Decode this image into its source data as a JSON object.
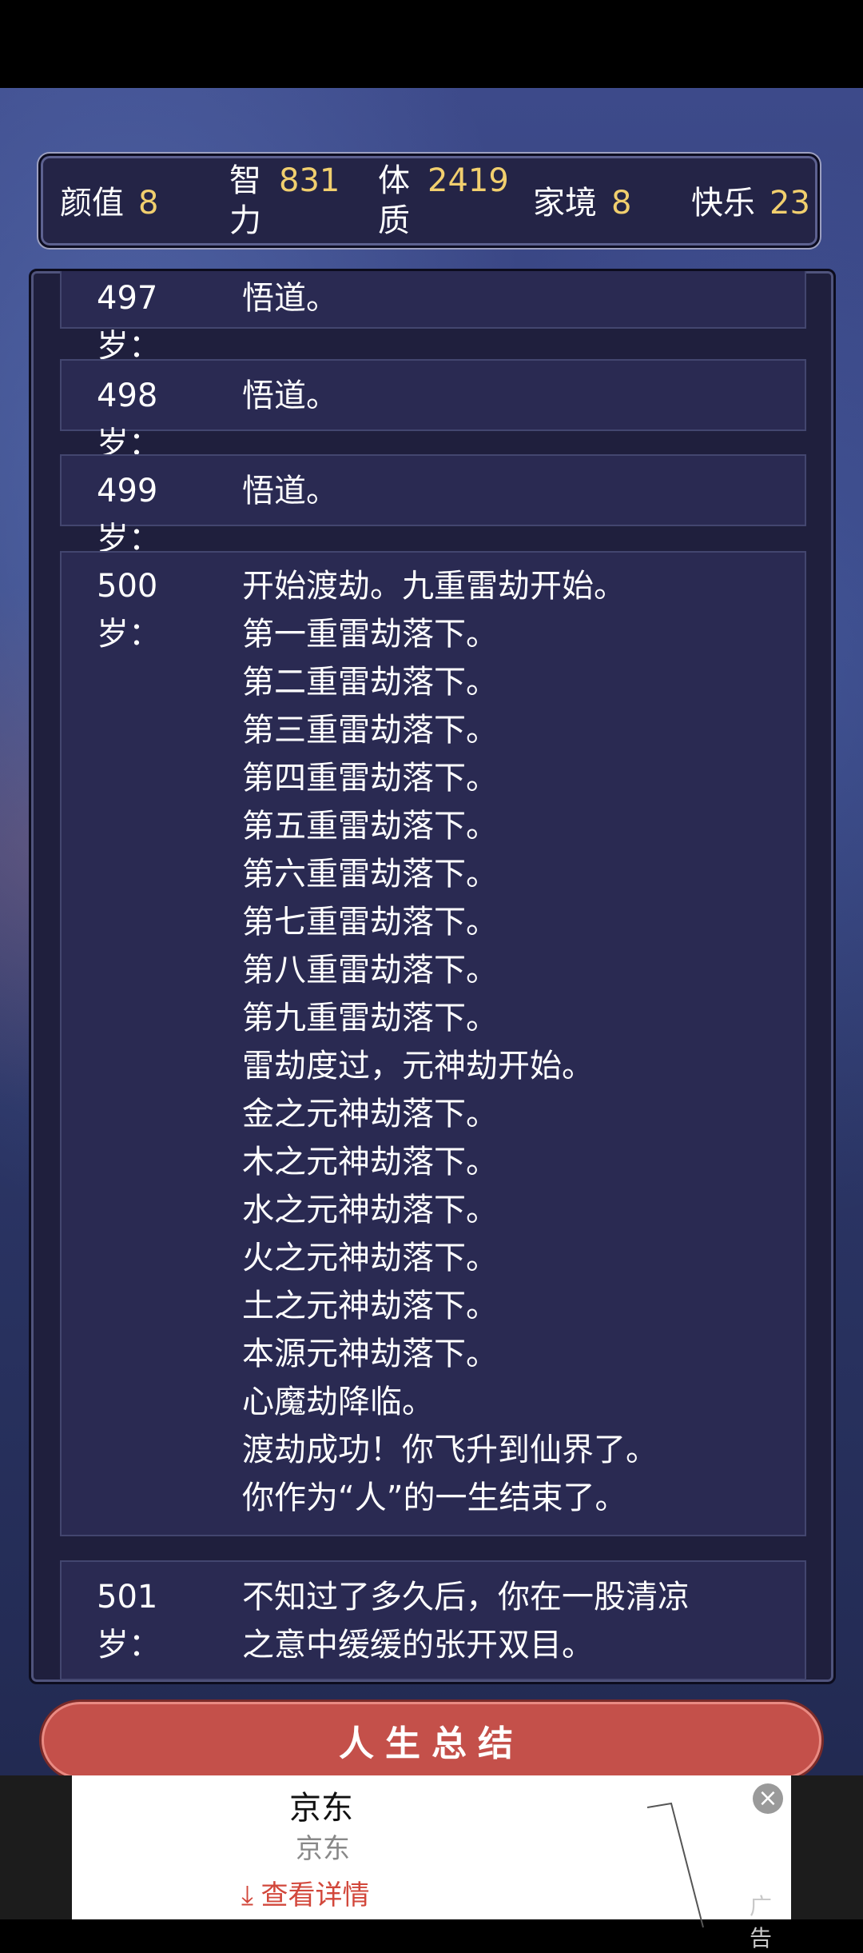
{
  "stats": [
    {
      "label": "颜值",
      "value": "8"
    },
    {
      "label": "智力",
      "value": "831"
    },
    {
      "label": "体质",
      "value": "2419"
    },
    {
      "label": "家境",
      "value": "8"
    },
    {
      "label": "快乐",
      "value": "23"
    }
  ],
  "log": [
    {
      "age": "497岁：",
      "lines": [
        "悟道。"
      ]
    },
    {
      "age": "498岁：",
      "lines": [
        "悟道。"
      ]
    },
    {
      "age": "499岁：",
      "lines": [
        "悟道。"
      ]
    },
    {
      "age": "500岁：",
      "lines": [
        "开始渡劫。九重雷劫开始。",
        "第一重雷劫落下。",
        "第二重雷劫落下。",
        "第三重雷劫落下。",
        "第四重雷劫落下。",
        "第五重雷劫落下。",
        "第六重雷劫落下。",
        "第七重雷劫落下。",
        "第八重雷劫落下。",
        "第九重雷劫落下。",
        "雷劫度过，元神劫开始。",
        "金之元神劫落下。",
        "木之元神劫落下。",
        "水之元神劫落下。",
        "火之元神劫落下。",
        "土之元神劫落下。",
        "本源元神劫落下。",
        "心魔劫降临。",
        "渡劫成功！你飞升到仙界了。",
        "你作为“人”的一生结束了。"
      ]
    },
    {
      "age": "501岁：",
      "lines": [
        "不知过了多久后，你在一股清凉",
        "之意中缓缓的张开双目。"
      ]
    }
  ],
  "summary_button": "人生总结",
  "ad": {
    "title": "京东",
    "subtitle": "京东",
    "more": "查看详情",
    "more_icon": "download-arrow-icon",
    "close_icon": "close-icon",
    "label": "广告"
  }
}
